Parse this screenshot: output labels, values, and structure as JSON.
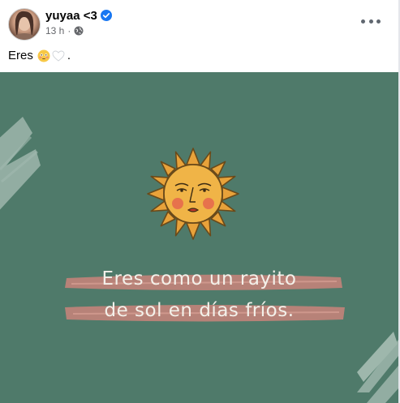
{
  "post": {
    "author": "yuyaa <3",
    "time": "13 h",
    "separator": "·",
    "caption_text": "Eres",
    "caption_emojis": [
      "flushed-face-emoji",
      "white-heart-emoji"
    ],
    "caption_end": "."
  },
  "image": {
    "line1": "Eres como un rayito",
    "line2": "de sol en días fríos."
  },
  "colors": {
    "background_green": "#4f7a6a",
    "verified_blue": "#1877f2",
    "sun_orange": "#e8a23a",
    "brush_pink": "#c9847a"
  }
}
